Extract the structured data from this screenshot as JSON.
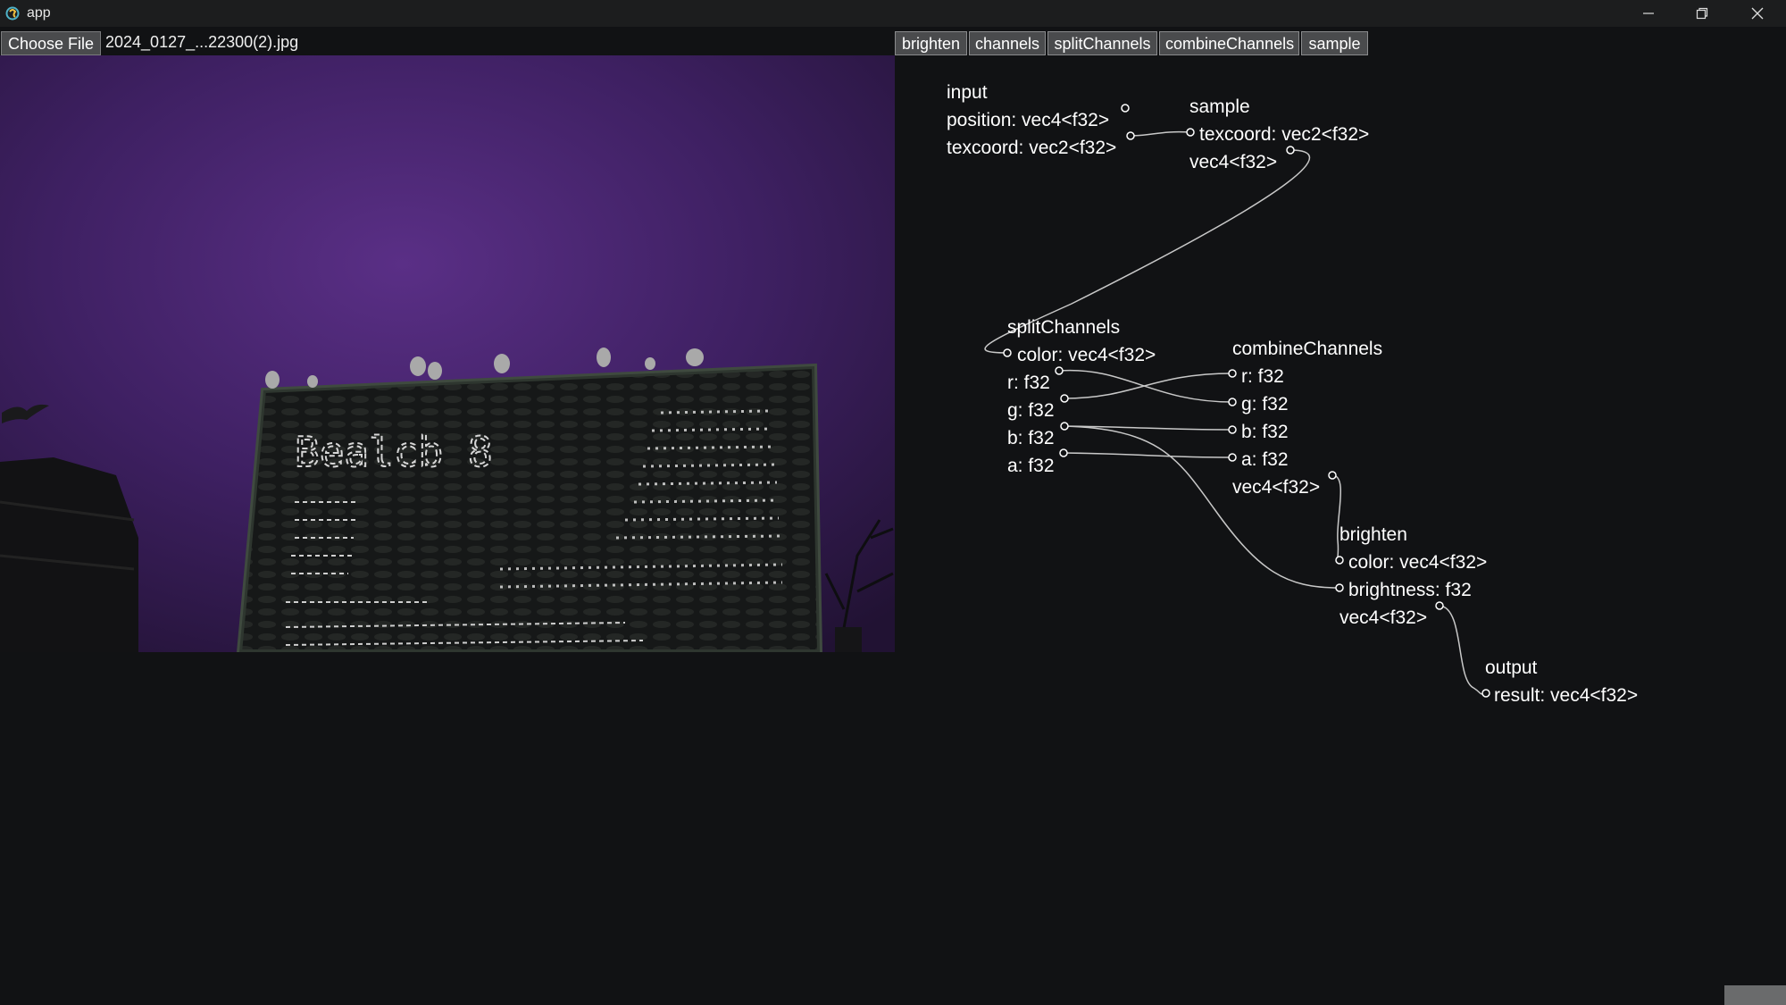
{
  "window": {
    "title": "app"
  },
  "toolbar": {
    "choose_file_label": "Choose File",
    "file_name": "2024_0127_...22300(2).jpg",
    "node_buttons": [
      "brighten",
      "channels",
      "splitChannels",
      "combineChannels",
      "sample"
    ]
  },
  "graph": {
    "nodes": {
      "input": {
        "title": "input",
        "ports": [
          "position: vec4<f32>",
          "texcoord: vec2<f32>"
        ]
      },
      "sample": {
        "title": "sample",
        "inputs": [
          "texcoord: vec2<f32>"
        ],
        "output": "vec4<f32>"
      },
      "splitChannels": {
        "title": "splitChannels",
        "inputs": [
          "color: vec4<f32>"
        ],
        "outputs": [
          "r: f32",
          "g: f32",
          "b: f32",
          "a: f32"
        ]
      },
      "combineChannels": {
        "title": "combineChannels",
        "inputs": [
          "r: f32",
          "g: f32",
          "b: f32",
          "a: f32"
        ],
        "output": "vec4<f32>"
      },
      "brighten": {
        "title": "brighten",
        "inputs": [
          "color: vec4<f32>",
          "brightness: f32"
        ],
        "output": "vec4<f32>"
      },
      "output": {
        "title": "output",
        "inputs": [
          "result: vec4<f32>"
        ]
      }
    },
    "connections": [
      {
        "from": "input.texcoord",
        "to": "sample.texcoord"
      },
      {
        "from": "sample.vec4",
        "to": "splitChannels.color"
      },
      {
        "from": "splitChannels.r",
        "to": "combineChannels.g"
      },
      {
        "from": "splitChannels.g",
        "to": "combineChannels.r"
      },
      {
        "from": "splitChannels.b",
        "to": "combineChannels.b"
      },
      {
        "from": "splitChannels.a",
        "to": "combineChannels.a"
      },
      {
        "from": "splitChannels.b",
        "to": "brighten.brightness"
      },
      {
        "from": "combineChannels.vec4",
        "to": "brighten.color"
      },
      {
        "from": "brighten.vec4",
        "to": "output.result"
      }
    ]
  },
  "preview_image": {
    "sign_text": "Bealcb 8"
  },
  "colors": {
    "background": "#111214",
    "titlebar": "#1c1d1e",
    "button_bg": "#4a4b4d",
    "sky_purple": "#4a2a6e",
    "wire": "#c8c8c8"
  },
  "icons": {
    "app": "app-logo-icon",
    "minimize": "minimize-icon",
    "maximize": "restore-icon",
    "close": "close-icon"
  }
}
